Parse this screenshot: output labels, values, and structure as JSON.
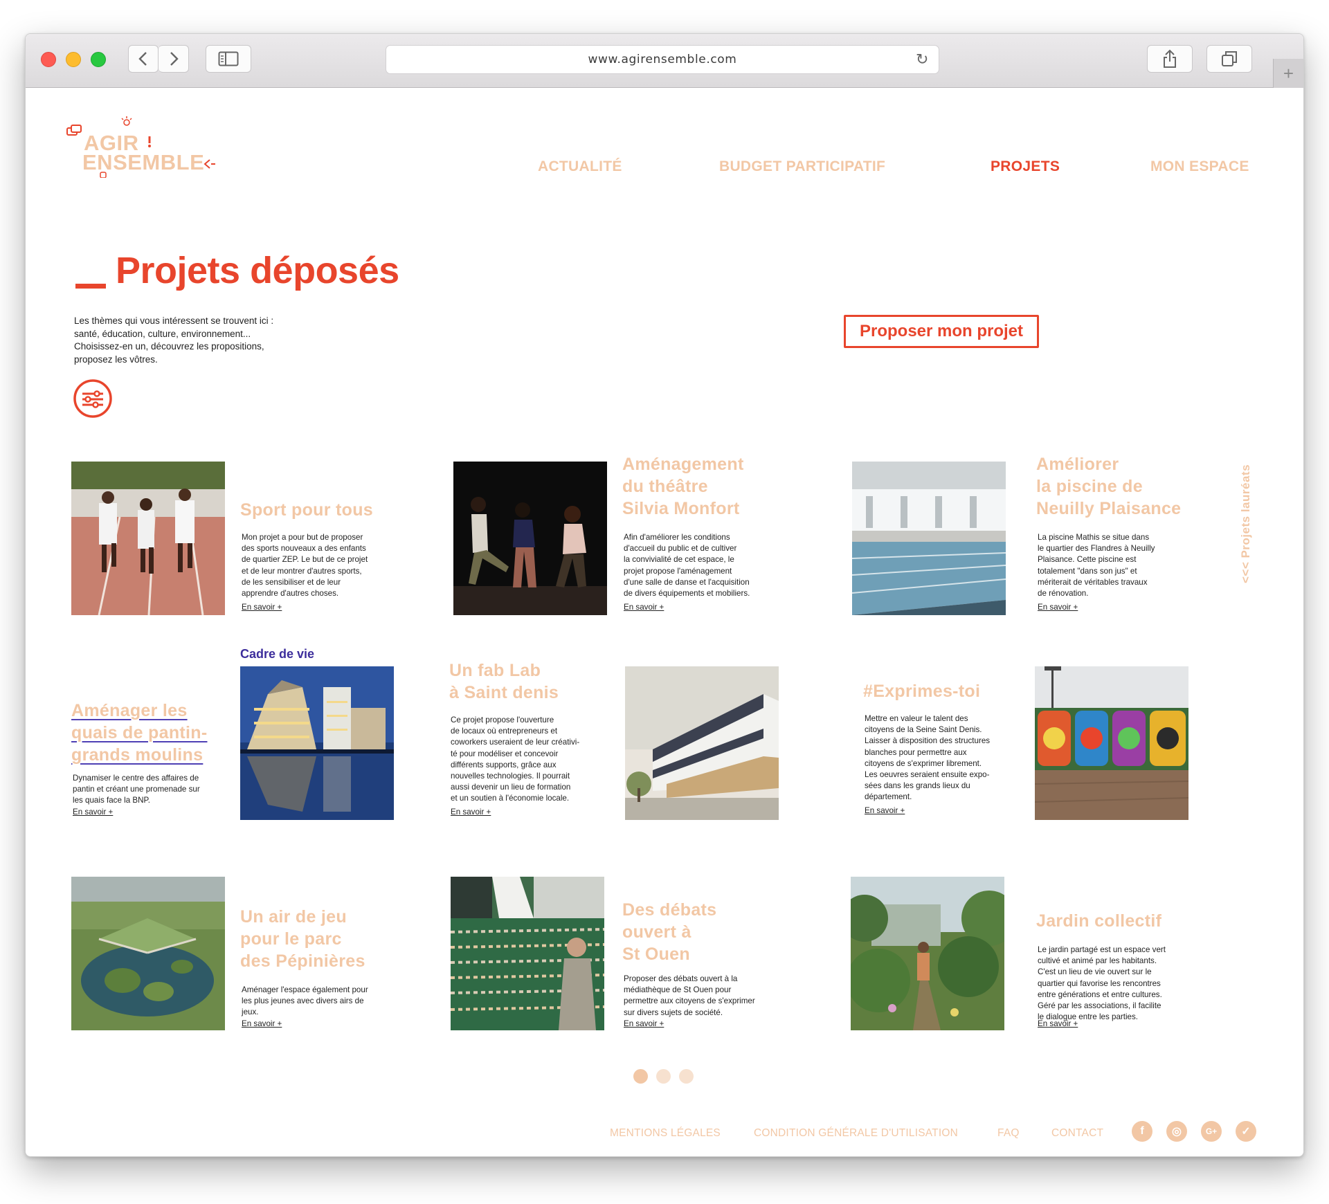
{
  "browser": {
    "url": "www.agirensemble.com",
    "back_icon": "chevron-left",
    "forward_icon": "chevron-right",
    "newtab_icon": "plus"
  },
  "logo": {
    "line1": "AGIR",
    "line2": "ENSEMBLE"
  },
  "nav": {
    "items": [
      {
        "label": "ACTUALITÉ"
      },
      {
        "label": "BUDGET PARTICIPATIF"
      },
      {
        "label": "PROJETS",
        "active": true
      },
      {
        "label": "MON ESPACE"
      }
    ]
  },
  "page": {
    "title": "Projets déposés",
    "intro": [
      "Les thèmes qui vous intéressent se trouvent ici :",
      "santé, éducation, culture, environnement...",
      "Choisissez-en un, découvrez les propositions,",
      "proposez les vôtres."
    ],
    "propose_button": "Proposer mon projet",
    "side_link": "<<< Projets lauréats"
  },
  "projects": [
    {
      "title": [
        "Sport pour tous"
      ],
      "desc": [
        "Mon projet a pour but de proposer",
        "des sports nouveaux a des enfants",
        "de quartier ZEP. Le but de ce projet",
        "et de leur montrer d'autres sports,",
        "de les sensibiliser et de leur",
        "apprendre d'autres choses."
      ],
      "more": "En savoir +"
    },
    {
      "title": [
        "Aménagement",
        "du théâtre",
        "Silvia Monfort"
      ],
      "desc": [
        "Afin d'améliorer les conditions",
        "d'accueil du public et de cultiver",
        "la convivialité de cet espace, le",
        "projet propose l'aménagement",
        "d'une salle de danse et l'acquisition",
        "de divers équipements et mobiliers."
      ],
      "more": "En savoir +"
    },
    {
      "title": [
        "Améliorer",
        "la piscine de",
        "Neuilly Plaisance"
      ],
      "desc": [
        "La piscine Mathis se situe dans",
        "le quartier des Flandres à Neuilly",
        "Plaisance. Cette piscine est",
        "totalement \"dans son jus\" et",
        "mériterait de véritables travaux",
        "de rénovation."
      ],
      "more": "En savoir +"
    },
    {
      "category": "Cadre de vie",
      "title": [
        "Aménager les",
        "quais de pantin-",
        "grands moulins"
      ],
      "desc": [
        "Dynamiser le centre des affaires de",
        "pantin et créant une promenade sur",
        "les quais face la BNP."
      ],
      "more": "En savoir +"
    },
    {
      "title": [
        "Un fab Lab",
        "à Saint denis"
      ],
      "desc": [
        "Ce projet propose l'ouverture",
        "de locaux où entrepreneurs et",
        "coworkers useraient de leur créativi-",
        "té pour modéliser et concevoir",
        "différents supports, grâce aux",
        "nouvelles technologies. Il pourrait",
        "aussi devenir un lieu de formation",
        "et un soutien à l'économie locale."
      ],
      "more": "En savoir +"
    },
    {
      "title": [
        "#Exprimes-toi"
      ],
      "desc": [
        "Mettre en valeur le talent des",
        "citoyens de la Seine Saint Denis.",
        "Laisser à disposition des structures",
        "blanches pour permettre aux",
        "citoyens de s'exprimer librement.",
        "Les oeuvres seraient ensuite expo-",
        "sées dans les grands lieux du",
        "département."
      ],
      "more": "En savoir +"
    },
    {
      "title": [
        "Un air de jeu",
        "pour le parc",
        "des Pépinières"
      ],
      "desc": [
        "Aménager l'espace également pour",
        "les plus jeunes avec divers airs de",
        "jeux."
      ],
      "more": "En savoir +"
    },
    {
      "title": [
        "Des débats",
        "ouvert à",
        "St Ouen"
      ],
      "desc": [
        "Proposer des débats ouvert à la",
        "médiathèque de St Ouen pour",
        "permettre aux citoyens de s'exprimer",
        "sur divers sujets de société."
      ],
      "more": "En savoir +"
    },
    {
      "title": [
        "Jardin collectif"
      ],
      "desc": [
        "Le jardin partagé est un espace vert",
        "cultivé et animé par les habitants.",
        "C'est un lieu de vie ouvert sur le",
        "quartier qui favorise les rencontres",
        "entre générations et entre cultures.",
        "Géré par les associations, il facilite",
        "le dialogue entre les parties."
      ],
      "more": "En savoir +"
    }
  ],
  "pagination": {
    "pages": 3,
    "current": 1
  },
  "footer": {
    "links": [
      "MENTIONS LÉGALES",
      "CONDITION GÉNÉRALE D'UTILISATION",
      "FAQ",
      "CONTACT"
    ],
    "social": [
      {
        "icon": "facebook-icon",
        "glyph": "f"
      },
      {
        "icon": "instagram-icon",
        "glyph": "◎"
      },
      {
        "icon": "google-plus-icon",
        "glyph": "G+"
      },
      {
        "icon": "twitter-icon",
        "glyph": "✓"
      }
    ]
  },
  "colors": {
    "accent": "#e8452c",
    "peach": "#f2c7a5",
    "category": "#3d2e9c",
    "underline": "#4e3fb4"
  }
}
